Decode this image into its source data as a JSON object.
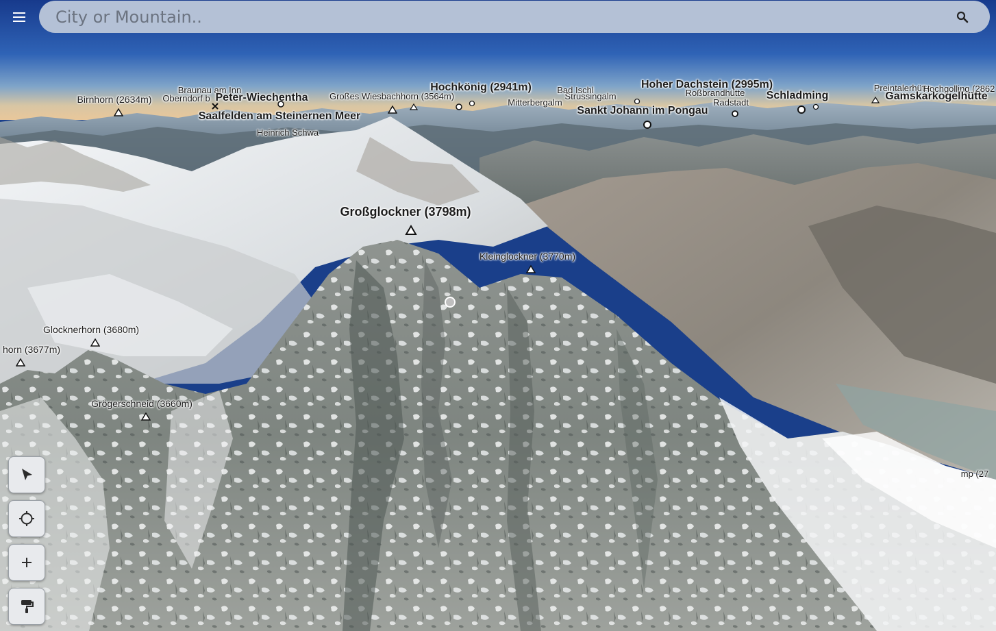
{
  "search": {
    "placeholder": "City or Mountain.."
  },
  "icons": {
    "menu": "hamburger-icon",
    "search": "magnifier-icon",
    "select": "cursor-arrow-icon",
    "locate": "crosshair-icon",
    "zoom_in": "plus-icon",
    "paint": "paint-roller-icon"
  },
  "labels": {
    "grossglockner": "Großglockner (3798m)",
    "kleinglockner": "Kleinglockner (3770m)",
    "glocknerhorn": "Glocknerhorn (3680m)",
    "horn3677": "horn (3677m)",
    "groegerschneid": "Grögerschneid (3660m)",
    "birnhorn": "Birnhorn (2634m)",
    "braunau": "Braunau am Inn",
    "oberndorf": "Oberndorf b",
    "peter": "Peter-Wiechentha",
    "saalfelden": "Saalfelden am Steinernen Meer",
    "heinrich": "Heinrich Schwa",
    "wiesbach": "Großes Wiesbachhorn (3564m)",
    "hochkoenig": "Hochkönig (2941m)",
    "mitterberg": "Mitterbergalm",
    "strussing": "Strussingalm",
    "bad_ischl": "Bad Ischl",
    "st_johann": "Sankt Johann im Pongau",
    "hoher_dachstein": "Hoher Dachstein (2995m)",
    "rossbrand": "Roßbrandhütte",
    "radstadt": "Radstadt",
    "schladming": "Schladming",
    "gamskar": "Gamskarkogelhütte",
    "preint": "Preintalerhütte",
    "hochgolling": "Hochgolling (2862",
    "right_edge": "mp (27"
  }
}
